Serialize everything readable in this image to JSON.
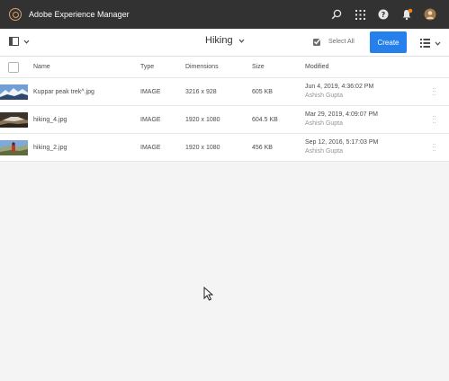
{
  "app": {
    "title": "Adobe Experience Manager"
  },
  "header_icons": [
    "search-icon",
    "solutions-grid-icon",
    "help-icon",
    "notifications-icon",
    "user-avatar-icon"
  ],
  "actionbar": {
    "title": "Hiking",
    "select_all": "Select All",
    "create": "Create"
  },
  "table": {
    "columns": [
      "Name",
      "Type",
      "Dimensions",
      "Size",
      "Modified"
    ],
    "rows": [
      {
        "name": "Kuppar peak trek^.jpg",
        "type": "IMAGE",
        "dimensions": "3216 x 928",
        "size": "605 KB",
        "modified": "Jun 4, 2019, 4:36:02 PM",
        "modified_by": "Ashish Gupta"
      },
      {
        "name": "hiking_4.jpg",
        "type": "IMAGE",
        "dimensions": "1920 x 1080",
        "size": "604.5 KB",
        "modified": "Mar 29, 2019, 4:09:07 PM",
        "modified_by": "Ashish Gupta"
      },
      {
        "name": "hiking_2.jpg",
        "type": "IMAGE",
        "dimensions": "1920 x 1080",
        "size": "456 KB",
        "modified": "Sep 12, 2016, 5:17:03 PM",
        "modified_by": "Ashish Gupta"
      }
    ]
  },
  "colors": {
    "topbar": "#323232",
    "accent": "#2680eb",
    "logo": "#d9a06a",
    "notification": "#e68619"
  }
}
